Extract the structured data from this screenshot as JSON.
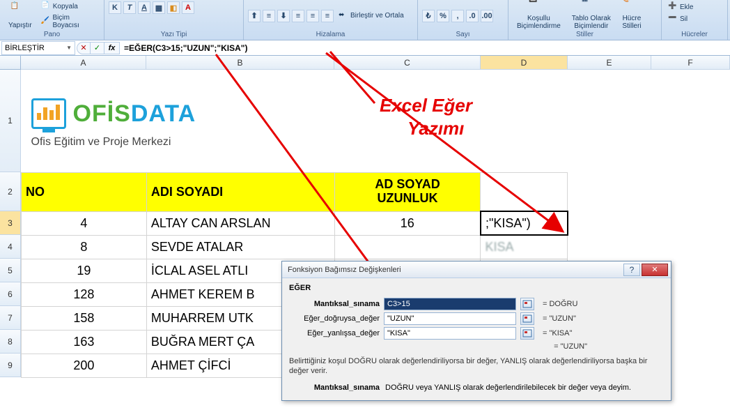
{
  "ribbon": {
    "paste": "Yapıştır",
    "copy": "Kopyala",
    "format_painter": "Biçim Boyacısı",
    "group_pano": "Pano",
    "group_font": "Yazı Tipi",
    "merge": "Birleştir ve Ortala",
    "group_align": "Hizalama",
    "group_number": "Sayı",
    "cond_fmt": "Koşullu\nBiçimlendirme",
    "tbl_fmt": "Tablo Olarak\nBiçimlendir",
    "cell_styles": "Hücre\nStilleri",
    "group_styles": "Stiller",
    "insert": "Ekle",
    "delete": "Sil",
    "group_cells": "Hücreler"
  },
  "formula_bar": {
    "name_box": "BİRLEŞTİR",
    "formula": "=EĞER(C3>15;\"UZUN\";\"KISA\")"
  },
  "columns": [
    "A",
    "B",
    "C",
    "D",
    "E",
    "F"
  ],
  "row_nums": [
    "1",
    "2",
    "3",
    "4",
    "5",
    "6",
    "7",
    "8",
    "9"
  ],
  "sheet": {
    "logo_text1": "OFİS",
    "logo_text2": "DATA",
    "logo_sub": "Ofis Eğitim ve Proje Merkezi",
    "hdr_no": "NO",
    "hdr_name": "ADI SOYADI",
    "hdr_len": "AD SOYAD\nUZUNLUK",
    "rows": [
      {
        "no": "4",
        "name": "ALTAY CAN ARSLAN",
        "len": "16",
        "d": ";\"KISA\")"
      },
      {
        "no": "8",
        "name": "SEVDE ATALAR",
        "len": "",
        "d": "KISA"
      },
      {
        "no": "19",
        "name": "İCLAL ASEL ATLI",
        "len": "",
        "d": ""
      },
      {
        "no": "128",
        "name": "AHMET KEREM B",
        "len": "",
        "d": ""
      },
      {
        "no": "158",
        "name": "MUHARREM UTK",
        "len": "",
        "d": ""
      },
      {
        "no": "163",
        "name": "BUĞRA MERT ÇA",
        "len": "",
        "d": ""
      },
      {
        "no": "200",
        "name": "AHMET ÇİFCİ",
        "len": "",
        "d": ""
      }
    ]
  },
  "annotation": {
    "l1": "Excel Eğer",
    "l2": "Yazımı"
  },
  "dialog": {
    "title": "Fonksiyon Bağımsız Değişkenleri",
    "fname": "EĞER",
    "arg1_label": "Mantıksal_sınama",
    "arg1_val": "C3>15",
    "arg1_r": "DOĞRU",
    "arg2_label": "Eğer_doğruysa_değer",
    "arg2_val": "\"UZUN\"",
    "arg2_r": "\"UZUN\"",
    "arg3_label": "Eğer_yanlışsa_değer",
    "arg3_val": "\"KISA\"",
    "arg3_r": "\"KISA\"",
    "result": "= \"UZUN\"",
    "desc": "Belirttiğiniz koşul DOĞRU olarak değerlendiriliyorsa bir değer, YANLIŞ olarak değerlendiriliyorsa başka bir değer verir.",
    "arg_help_name": "Mantıksal_sınama",
    "arg_help_text": "DOĞRU veya YANLIŞ olarak değerlendirilebilecek bir değer veya deyim."
  }
}
